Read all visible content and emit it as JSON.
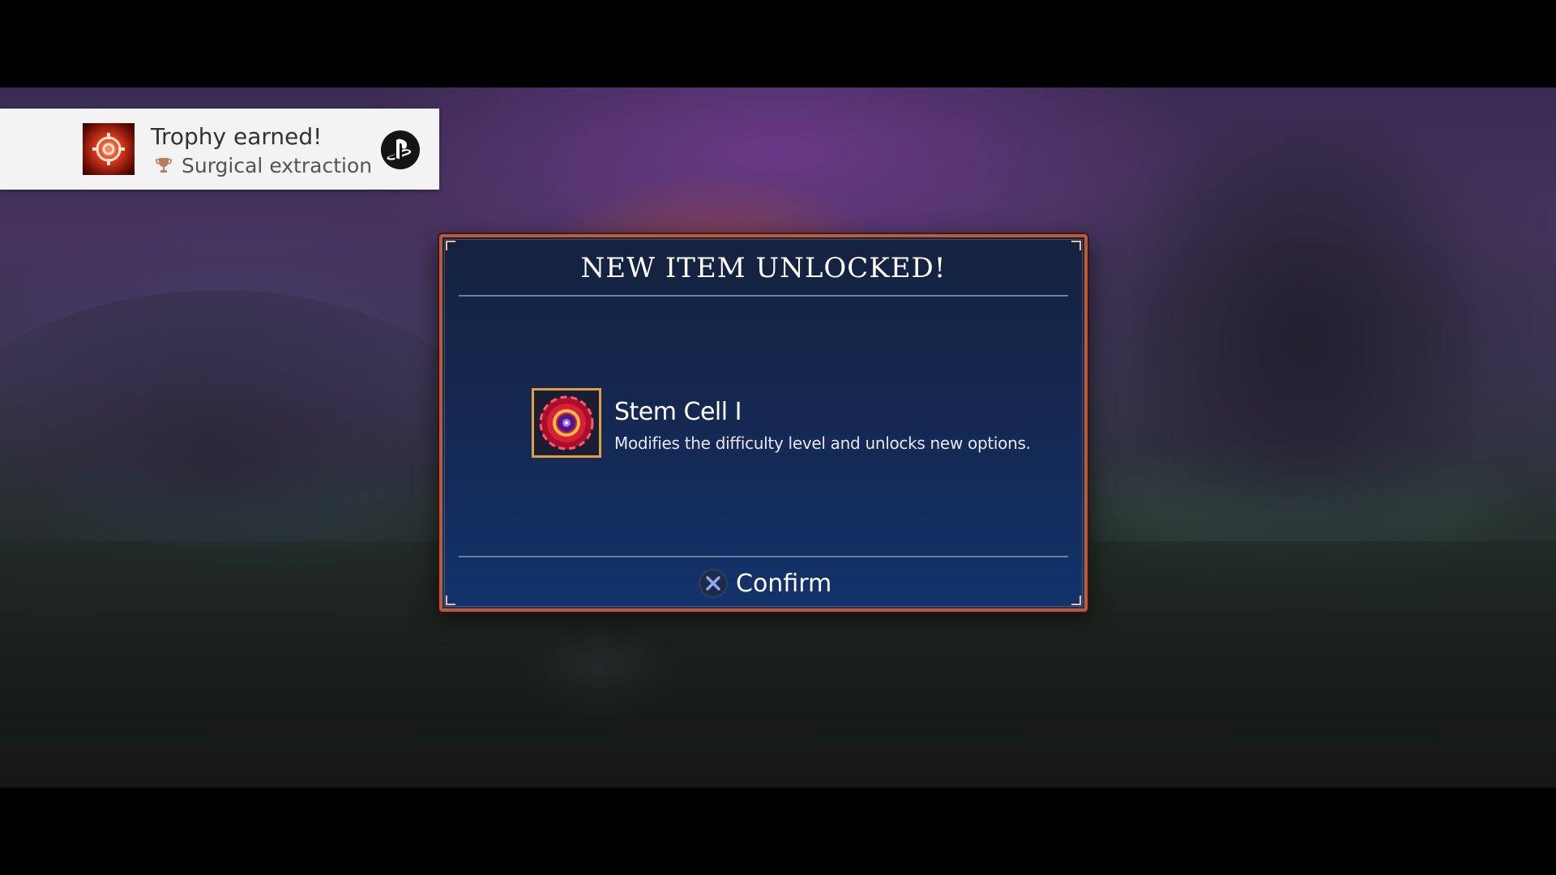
{
  "notification": {
    "title": "Trophy earned!",
    "trophy_name": "Surgical extraction",
    "trophy_tier_color": "#b87d5a",
    "icon": "trophy-game-icon",
    "platform_icon": "playstation-icon"
  },
  "dialog": {
    "title": "NEW ITEM UNLOCKED!",
    "item": {
      "name": "Stem Cell I",
      "description": "Modifies the difficulty level and unlocks new options.",
      "icon": "stem-cell-icon"
    },
    "confirm": {
      "button_glyph": "cross-button-icon",
      "label": "Confirm"
    }
  },
  "colors": {
    "dialog_border": "#b85a3c",
    "dialog_bg": "#142852",
    "item_frame": "#e0a040",
    "toast_bg": "#f3f3f3"
  }
}
